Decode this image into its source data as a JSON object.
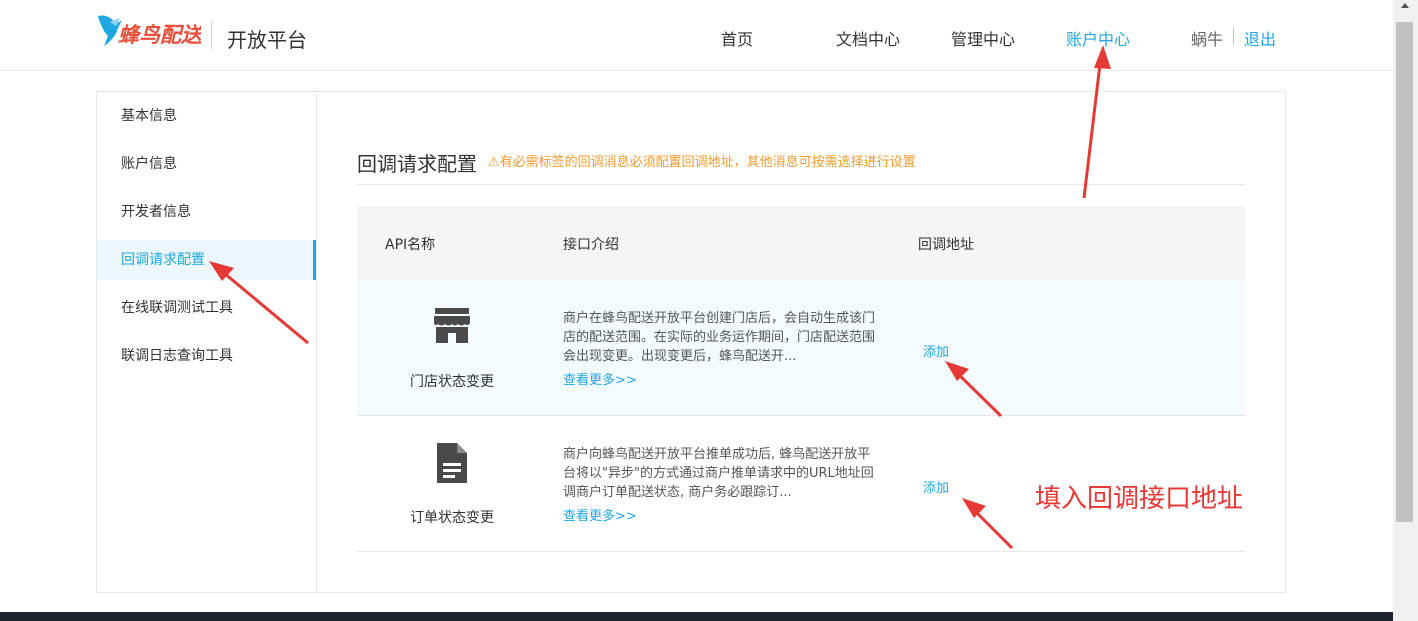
{
  "header": {
    "brand": "蜂鸟配送",
    "platform_title": "开放平台",
    "nav": [
      {
        "label": "首页"
      },
      {
        "label": "文档中心"
      },
      {
        "label": "管理中心"
      },
      {
        "label": "账户中心"
      }
    ],
    "active_nav": "账户中心",
    "user_name": "蜗牛",
    "logout": "退出"
  },
  "sidebar": {
    "items": [
      {
        "label": "基本信息"
      },
      {
        "label": "账户信息"
      },
      {
        "label": "开发者信息"
      },
      {
        "label": "回调请求配置"
      },
      {
        "label": "在线联调测试工具"
      },
      {
        "label": "联调日志查询工具"
      }
    ],
    "active": "回调请求配置"
  },
  "main": {
    "title": "回调请求配置",
    "warning": "⚠有必需标签的回调消息必须配置回调地址，其他消息可按需选择进行设置",
    "table": {
      "headers": [
        "API名称",
        "接口介绍",
        "回调地址"
      ],
      "rows": [
        {
          "icon": "store-icon",
          "name": "门店状态变更",
          "description": "商户在蜂鸟配送开放平台创建门店后，会自动生成该门店的配送范围。在实际的业务运作期间，门店配送范围会出现变更。出现变更后，蜂鸟配送开...",
          "more": "查看更多>>",
          "action": "添加"
        },
        {
          "icon": "document-icon",
          "name": "订单状态变更",
          "description": "商户向蜂鸟配送开放平台推单成功后, 蜂鸟配送开放平台将以\"异步\"的方式通过商户推单请求中的URL地址回调商户订单配送状态, 商户务必跟踪订...",
          "more": "查看更多>>",
          "action": "添加"
        }
      ]
    }
  },
  "annotation": {
    "text": "填入回调接口地址"
  },
  "colors": {
    "accent": "#1fa7e4",
    "warning": "#f29a2e",
    "annotation": "#e53935",
    "brand": "#e8503a"
  }
}
